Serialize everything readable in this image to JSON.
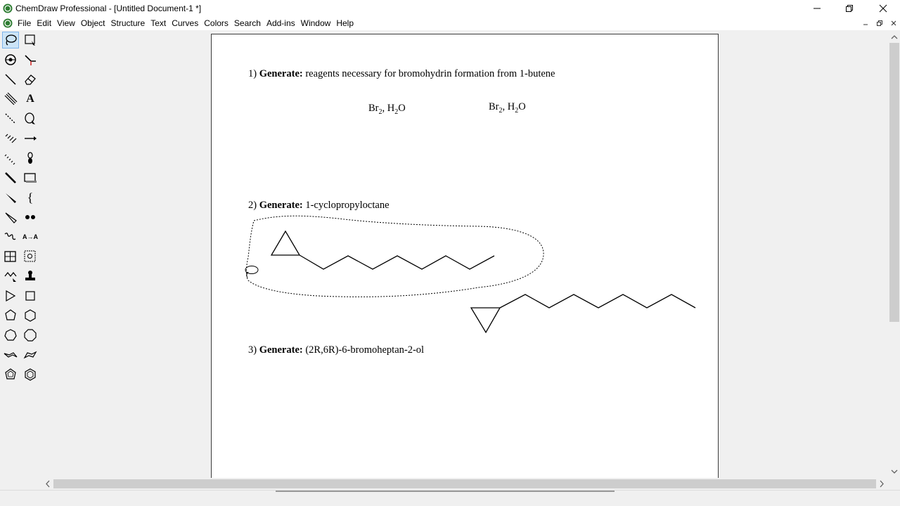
{
  "window": {
    "title": "ChemDraw Professional - [Untitled Document-1 *]",
    "controls": [
      "minimize-icon",
      "restore-icon",
      "close-icon"
    ]
  },
  "menu": {
    "items": [
      "File",
      "Edit",
      "View",
      "Object",
      "Structure",
      "Text",
      "Curves",
      "Colors",
      "Search",
      "Add-ins",
      "Window",
      "Help"
    ]
  },
  "mdi": {
    "controls": [
      "mdi-minimize-icon",
      "mdi-restore-icon",
      "mdi-close-icon"
    ]
  },
  "toolbar": {
    "tools": [
      {
        "name": "lasso-tool",
        "selected": true
      },
      {
        "name": "marquee-tool"
      },
      {
        "name": "structure-perspective-tool"
      },
      {
        "name": "bond-tool-2"
      },
      {
        "name": "solid-bond-tool"
      },
      {
        "name": "eraser-tool"
      },
      {
        "name": "hashed-bond-tool"
      },
      {
        "name": "text-tool",
        "glyph": "A"
      },
      {
        "name": "dashed-bond-tool"
      },
      {
        "name": "pen-tool"
      },
      {
        "name": "hashed-wedge-tool"
      },
      {
        "name": "arrow-tool"
      },
      {
        "name": "wavy-hash-tool"
      },
      {
        "name": "orbital-tool"
      },
      {
        "name": "bold-bond-tool"
      },
      {
        "name": "rectangle-tool"
      },
      {
        "name": "wedge-bond-tool"
      },
      {
        "name": "bracket-tool",
        "glyph": "{"
      },
      {
        "name": "hollow-wedge-tool"
      },
      {
        "name": "charge-tool"
      },
      {
        "name": "wavy-bond-tool"
      },
      {
        "name": "mapping-tool",
        "glyph": "A→A"
      },
      {
        "name": "table-tool"
      },
      {
        "name": "template-tool"
      },
      {
        "name": "chain-tool"
      },
      {
        "name": "stamp-tool"
      },
      {
        "name": "cyclopropane-tool"
      },
      {
        "name": "cyclobutane-tool"
      },
      {
        "name": "cyclopentane-tool"
      },
      {
        "name": "cyclohexane-tool"
      },
      {
        "name": "cyclopentadiene-tool"
      },
      {
        "name": "cycloheptane-tool"
      },
      {
        "name": "chair-1-tool"
      },
      {
        "name": "chair-2-tool"
      },
      {
        "name": "cyclopentane-ring-tool"
      },
      {
        "name": "benzene-tool"
      }
    ]
  },
  "document": {
    "q1": {
      "num": "1)",
      "label": "Generate:",
      "text": "reagents necessary for bromohydrin formation from 1-butene"
    },
    "reagents": [
      {
        "a": "Br",
        "a_sub": "2",
        "sep": ", H",
        "b_sub": "2",
        "b": "O"
      },
      {
        "a": "Br",
        "a_sub": "2",
        "sep": ", H",
        "b_sub": "2",
        "b": "O"
      }
    ],
    "q2": {
      "num": "2)",
      "label": "Generate:",
      "text": "1-cyclopropyloctane"
    },
    "q3": {
      "num": "3)",
      "label": "Generate:",
      "text": "(2R,6R)-6-bromoheptan-2-ol"
    }
  },
  "colors": {
    "selection": "#cce4f7",
    "selection_border": "#7eb4ea",
    "chrome": "#f0f0f0",
    "page": "#ffffff"
  }
}
